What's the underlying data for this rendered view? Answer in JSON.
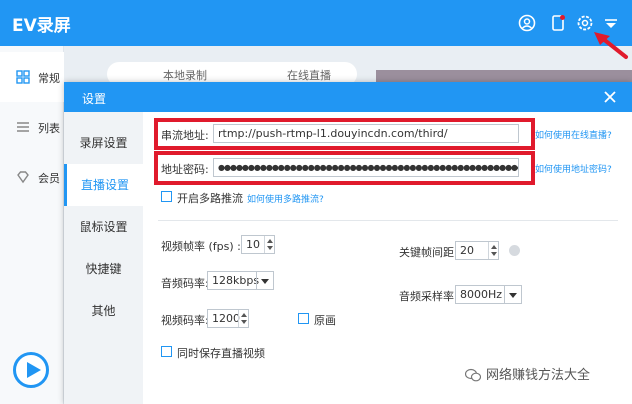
{
  "app": {
    "title": "EV录屏",
    "nav": [
      {
        "label": "常规"
      },
      {
        "label": "列表"
      },
      {
        "label": "会员"
      }
    ],
    "tabs": [
      "本地录制",
      "在线直播"
    ]
  },
  "dialog": {
    "title": "设置",
    "sidebar": [
      "录屏设置",
      "直播设置",
      "鼠标设置",
      "快捷键",
      "其他"
    ],
    "stream_url_label": "串流地址:",
    "stream_url_value": "rtmp://push-rtmp-l1.douyincdn.com/third/",
    "stream_url_help": "如何使用在线直播?",
    "stream_key_label": "地址密码:",
    "stream_key_value": "●●●●●●●●●●●●●●●●●●●●●●●●●●●●●●●●●●●●●●●●●●●●●●●●●●●●●●",
    "stream_key_help": "如何使用地址密码?",
    "multi_push_label": "开启多路推流",
    "multi_push_help": "如何使用多路推流?",
    "fps_label": "视频帧率 (fps) :",
    "fps_value": "10",
    "keyframe_label": "关键帧间距:",
    "keyframe_value": "20",
    "audio_bitrate_label": "音频码率:",
    "audio_bitrate_value": "128kbps",
    "audio_sample_label": "音频采样率:",
    "audio_sample_value": "8000Hz",
    "video_bitrate_label": "视频码率:",
    "video_bitrate_value": "1200",
    "original_label": "原画",
    "save_video_label": "同时保存直播视频"
  },
  "watermark": "网络赚钱方法大全",
  "colors": {
    "primary": "#2196f3",
    "highlight": "#e01a2c"
  }
}
